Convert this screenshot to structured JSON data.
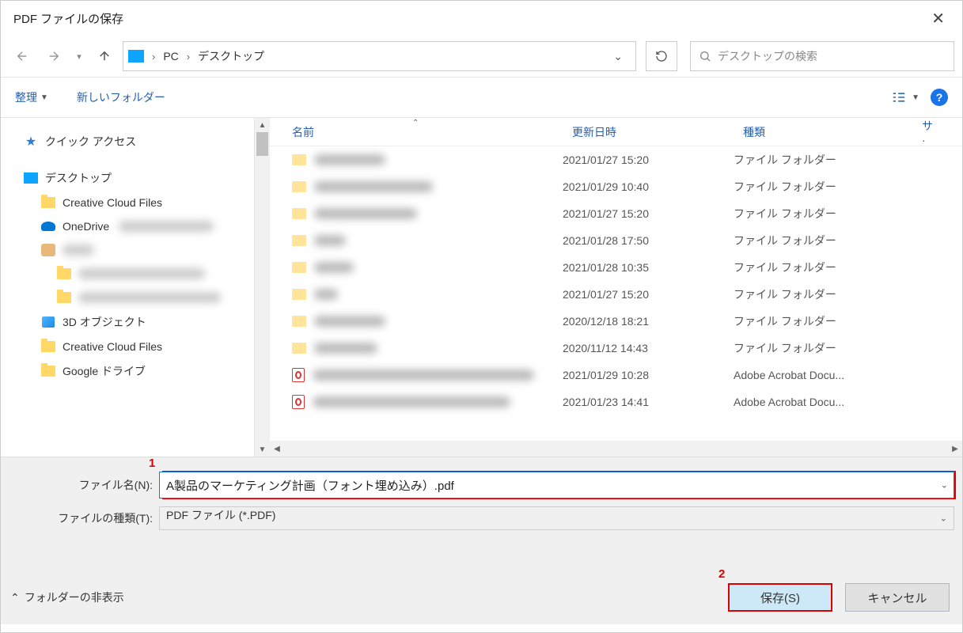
{
  "title": "PDF ファイルの保存",
  "nav": {
    "back": "←",
    "forward": "→",
    "up": "↑"
  },
  "address": {
    "segments": [
      "PC",
      "デスクトップ"
    ]
  },
  "refresh_icon": "↻",
  "search": {
    "placeholder": "デスクトップの検索"
  },
  "toolbar": {
    "organize": "整理",
    "new_folder": "新しいフォルダー",
    "help": "?"
  },
  "sidebar": {
    "quick_access": "クイック アクセス",
    "desktop": "デスクトップ",
    "ccf": "Creative Cloud Files",
    "onedrive": "OneDrive",
    "objects3d": "3D オブジェクト",
    "ccf2": "Creative Cloud Files",
    "gdrive": "Google ドライブ"
  },
  "columns": {
    "name": "名前",
    "date": "更新日時",
    "type": "種類",
    "size_trunc": "サ·"
  },
  "rows": [
    {
      "date": "2021/01/27 15:20",
      "type": "ファイル フォルダー",
      "kind": "folder",
      "nameW": 90
    },
    {
      "date": "2021/01/29 10:40",
      "type": "ファイル フォルダー",
      "kind": "folder",
      "nameW": 150
    },
    {
      "date": "2021/01/27 15:20",
      "type": "ファイル フォルダー",
      "kind": "folder",
      "nameW": 130
    },
    {
      "date": "2021/01/28 17:50",
      "type": "ファイル フォルダー",
      "kind": "folder",
      "nameW": 40
    },
    {
      "date": "2021/01/28 10:35",
      "type": "ファイル フォルダー",
      "kind": "folder",
      "nameW": 50
    },
    {
      "date": "2021/01/27 15:20",
      "type": "ファイル フォルダー",
      "kind": "folder",
      "nameW": 30
    },
    {
      "date": "2020/12/18 18:21",
      "type": "ファイル フォルダー",
      "kind": "folder",
      "nameW": 90
    },
    {
      "date": "2020/11/12 14:43",
      "type": "ファイル フォルダー",
      "kind": "folder",
      "nameW": 80
    },
    {
      "date": "2021/01/29 10:28",
      "type": "Adobe Acrobat Docu...",
      "kind": "pdf",
      "nameW": 280
    },
    {
      "date": "2021/01/23 14:41",
      "type": "Adobe Acrobat Docu...",
      "kind": "pdf",
      "nameW": 250
    }
  ],
  "filename_label": "ファイル名(N):",
  "filename_value": "A製品のマーケティング計画（フォント埋め込み）.pdf",
  "filetype_label": "ファイルの種類(T):",
  "filetype_value": "PDF ファイル (*.PDF)",
  "hide_folders": "フォルダーの非表示",
  "save_btn": "保存(S)",
  "cancel_btn": "キャンセル",
  "annotations": {
    "one": "1",
    "two": "2"
  }
}
